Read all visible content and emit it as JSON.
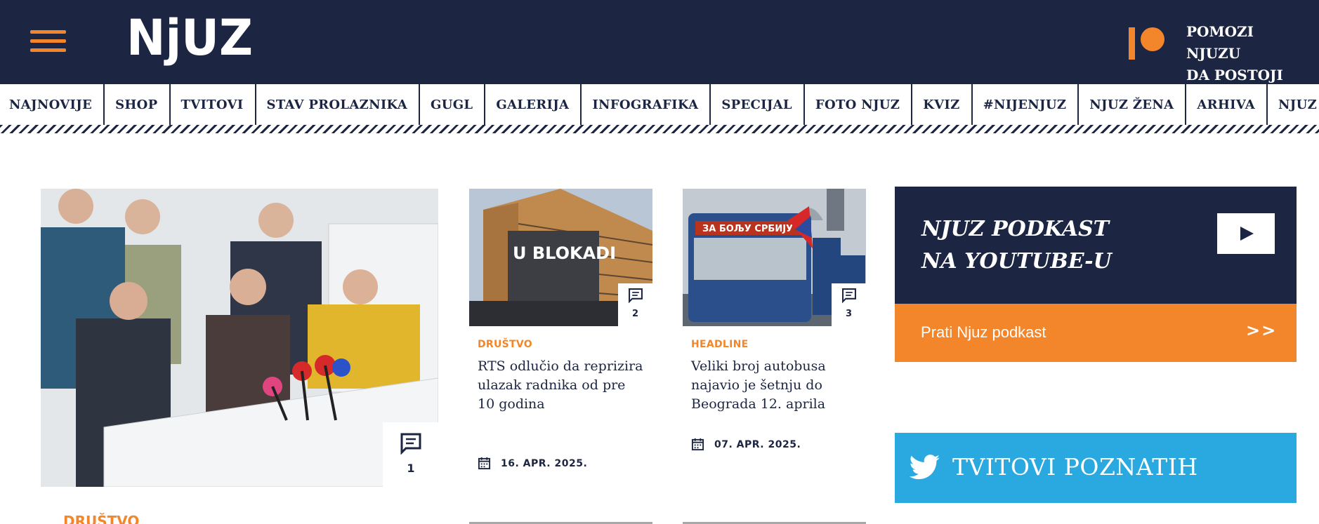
{
  "header": {
    "logo_text": "NjUZ",
    "support_line1": "POMOZI NJUZU",
    "support_line2": "DA POSTOJI"
  },
  "nav": {
    "items": [
      "NAJNOVIJE",
      "SHOP",
      "TVITOVI",
      "STAV PROLAZNIKA",
      "GUGL",
      "GALERIJA",
      "INFOGRAFIKA",
      "SPECIJAL",
      "FOTO NJUZ",
      "KVIZ",
      "#NIJENJUZ",
      "NJUZ ŽENA",
      "ARHIVA",
      "NJUZ IGRE"
    ]
  },
  "featured": {
    "comment_count": "1",
    "category": "DRUŠTVO"
  },
  "articles": [
    {
      "category": "DRUŠTVO",
      "title": "RTS odlučio da reprizira ulazak radnika od pre 10 godina",
      "date": "16. APR. 2025.",
      "comment_count": "2",
      "image_text": "U BLOKADI"
    },
    {
      "category": "HEADLINE",
      "title": "Veliki broj autobusa najavio je šetnju do Beograda 12. aprila",
      "date": "07. APR. 2025.",
      "comment_count": "3",
      "image_text": "ЗА БОЉУ СРБИЈУ"
    }
  ],
  "podcast": {
    "title_line1": "NJUZ PODKAST",
    "title_line2": "NA YOUTUBE-U",
    "follow_label": "Prati Njuz podkast",
    "arrows": ">>"
  },
  "tweets": {
    "label": "TVITOVI POZNATIH"
  },
  "colors": {
    "navy": "#1c2541",
    "orange": "#f3862a",
    "twitter_blue": "#2aa9e0"
  },
  "icons": [
    "menu-icon",
    "patreon-icon",
    "comment-icon",
    "calendar-icon",
    "play-icon",
    "twitter-icon"
  ]
}
